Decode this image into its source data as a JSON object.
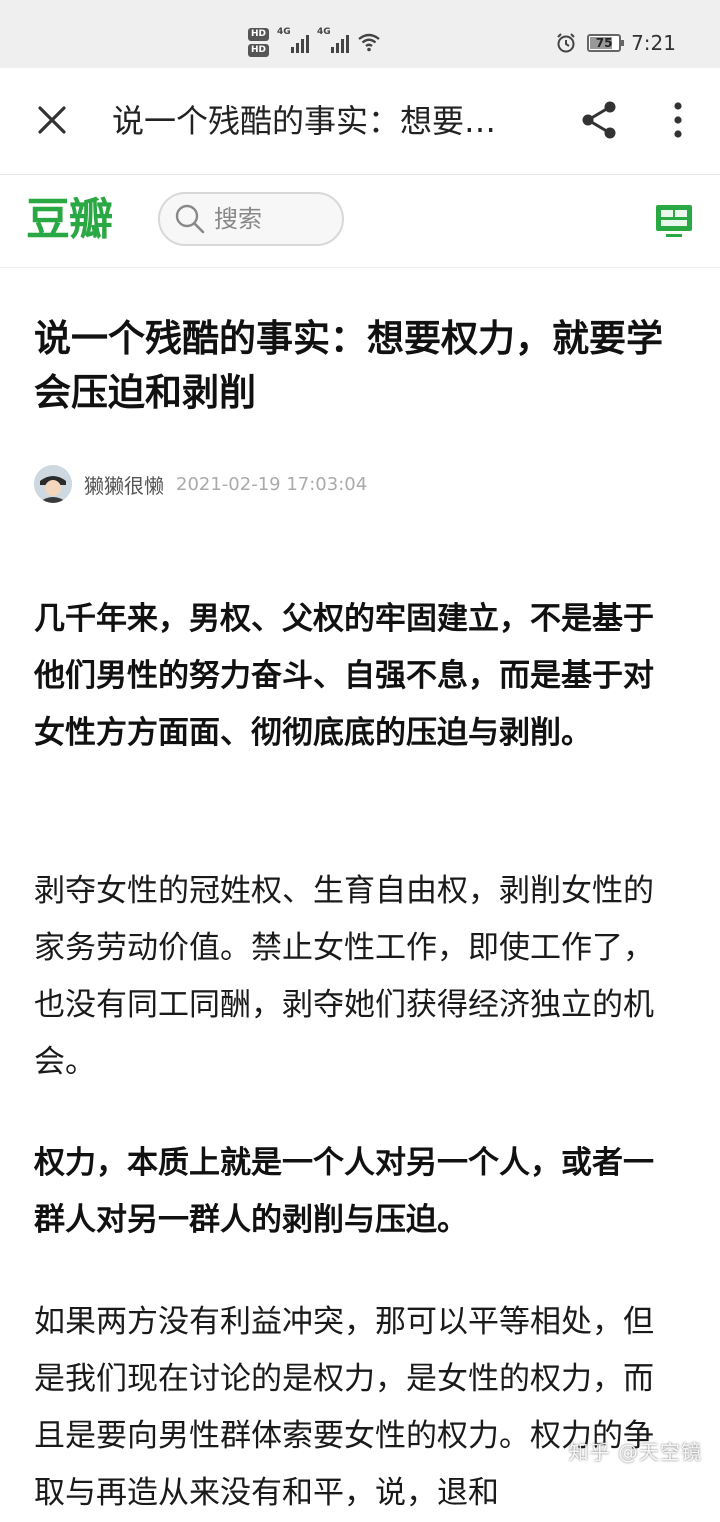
{
  "status_bar": {
    "hd1": "HD",
    "hd2": "HD",
    "network1": "4G",
    "network2": "4G",
    "battery_level": "75",
    "time": "7:21"
  },
  "app_bar": {
    "title": "说一个残酷的事实：想要权力，就要学会压迫和剥削"
  },
  "douban": {
    "logo": "豆瓣",
    "search_placeholder": "搜索",
    "brand_color": "#2aa843"
  },
  "article": {
    "title": "说一个残酷的事实：想要权力，就要学会压迫和剥削",
    "author": "獭獭很懒",
    "published": "2021-02-19 17:03:04",
    "paragraphs": [
      "几千年来，男权、父权的牢固建立，不是基于他们男性的努力奋斗、自强不息，而是基于对女性方方面面、彻彻底底的压迫与剥削。",
      "剥夺女性的冠姓权、生育自由权，剥削女性的家务劳动价值。禁止女性工作，即使工作了，也没有同工同酬，剥夺她们获得经济独立的机会。",
      "权力，本质上就是一个人对另一个人，或者一群人对另一群人的剥削与压迫。",
      "如果两方没有利益冲突，那可以平等相处，但是我们现在讨论的是权力，是女性的权力，而且是要向男性群体索要女性的权力。权力的争取与再造从来没有和平，说，退和"
    ]
  },
  "watermark": "知乎 @天空镜"
}
